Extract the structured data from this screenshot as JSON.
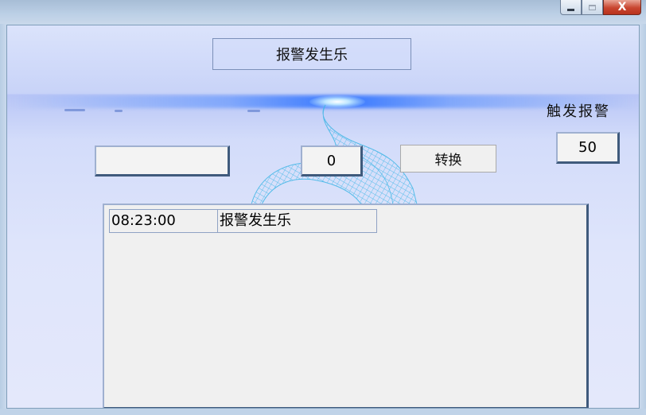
{
  "window": {
    "minimize_label": "",
    "maximize_label": "",
    "close_label": "X"
  },
  "app": {
    "title_button": "报警发生乐",
    "trigger_label": "触发报警",
    "threshold_value": "50",
    "input_left_value": "",
    "input_count_value": "0",
    "convert_button": "转换"
  },
  "log": {
    "rows": [
      {
        "time": "08:23:00",
        "message": "报警发生乐"
      }
    ]
  },
  "colors": {
    "accent_beam": "#2a6eff",
    "mesh": "#3fb6e6",
    "close_button": "#c8452f"
  }
}
